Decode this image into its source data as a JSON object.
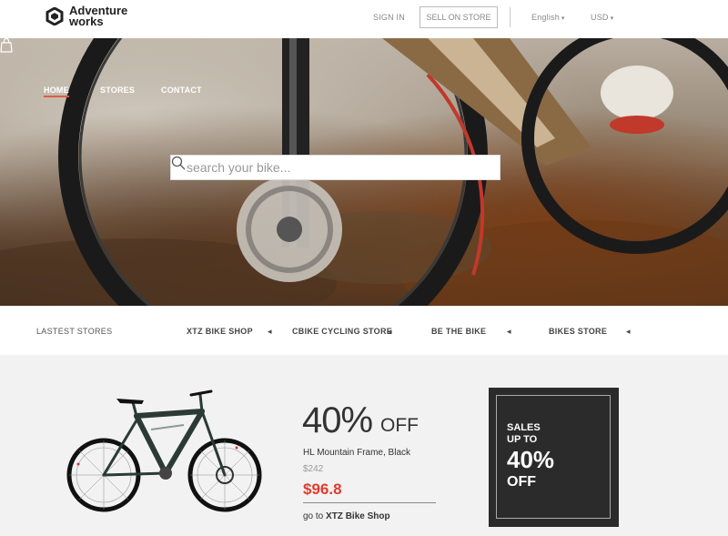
{
  "brand": {
    "line1": "Adventure",
    "line2": "works"
  },
  "topbar": {
    "sign_in": "SIGN IN",
    "sell_on_store": "SELL ON STORE",
    "language": "English",
    "currency": "USD"
  },
  "nav": {
    "home": "HOME",
    "stores": "STORES",
    "contact": "CONTACT"
  },
  "search": {
    "placeholder": "search your bike..."
  },
  "stores": {
    "label": "LASTEST STORES",
    "items": [
      "XTZ BIKE SHOP",
      "CBIKE CYCLING STORE",
      "BE THE BIKE",
      "BIKES STORE"
    ]
  },
  "promo": {
    "percent": "40%",
    "off": "OFF",
    "product_name": "HL Mountain Frame, Black",
    "old_price": "$242",
    "new_price": "$96.8",
    "goto_prefix": "go to",
    "goto_store": "XTZ Bike Shop"
  },
  "sale_box": {
    "line1": "SALES",
    "line2": "UP TO",
    "percent": "40%",
    "off": "OFF"
  },
  "colors": {
    "accent": "#e03b2e",
    "dark_box": "#2c2b2b",
    "promo_bg": "#f2f2f2"
  }
}
